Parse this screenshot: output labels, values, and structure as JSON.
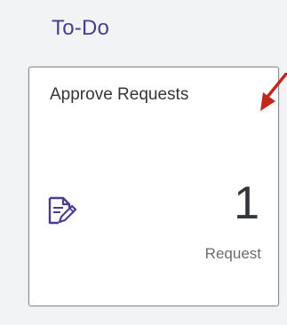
{
  "section": {
    "title": "To-Do"
  },
  "tile": {
    "title": "Approve Requests",
    "count": "1",
    "unit": "Request",
    "icon": "document-edit-icon"
  },
  "annotation": {
    "icon": "red-arrow-icon",
    "color": "#c0281e"
  },
  "colors": {
    "section_title": "#4a3d8f",
    "icon": "#4a3d8f",
    "background": "#f2f3f4"
  }
}
